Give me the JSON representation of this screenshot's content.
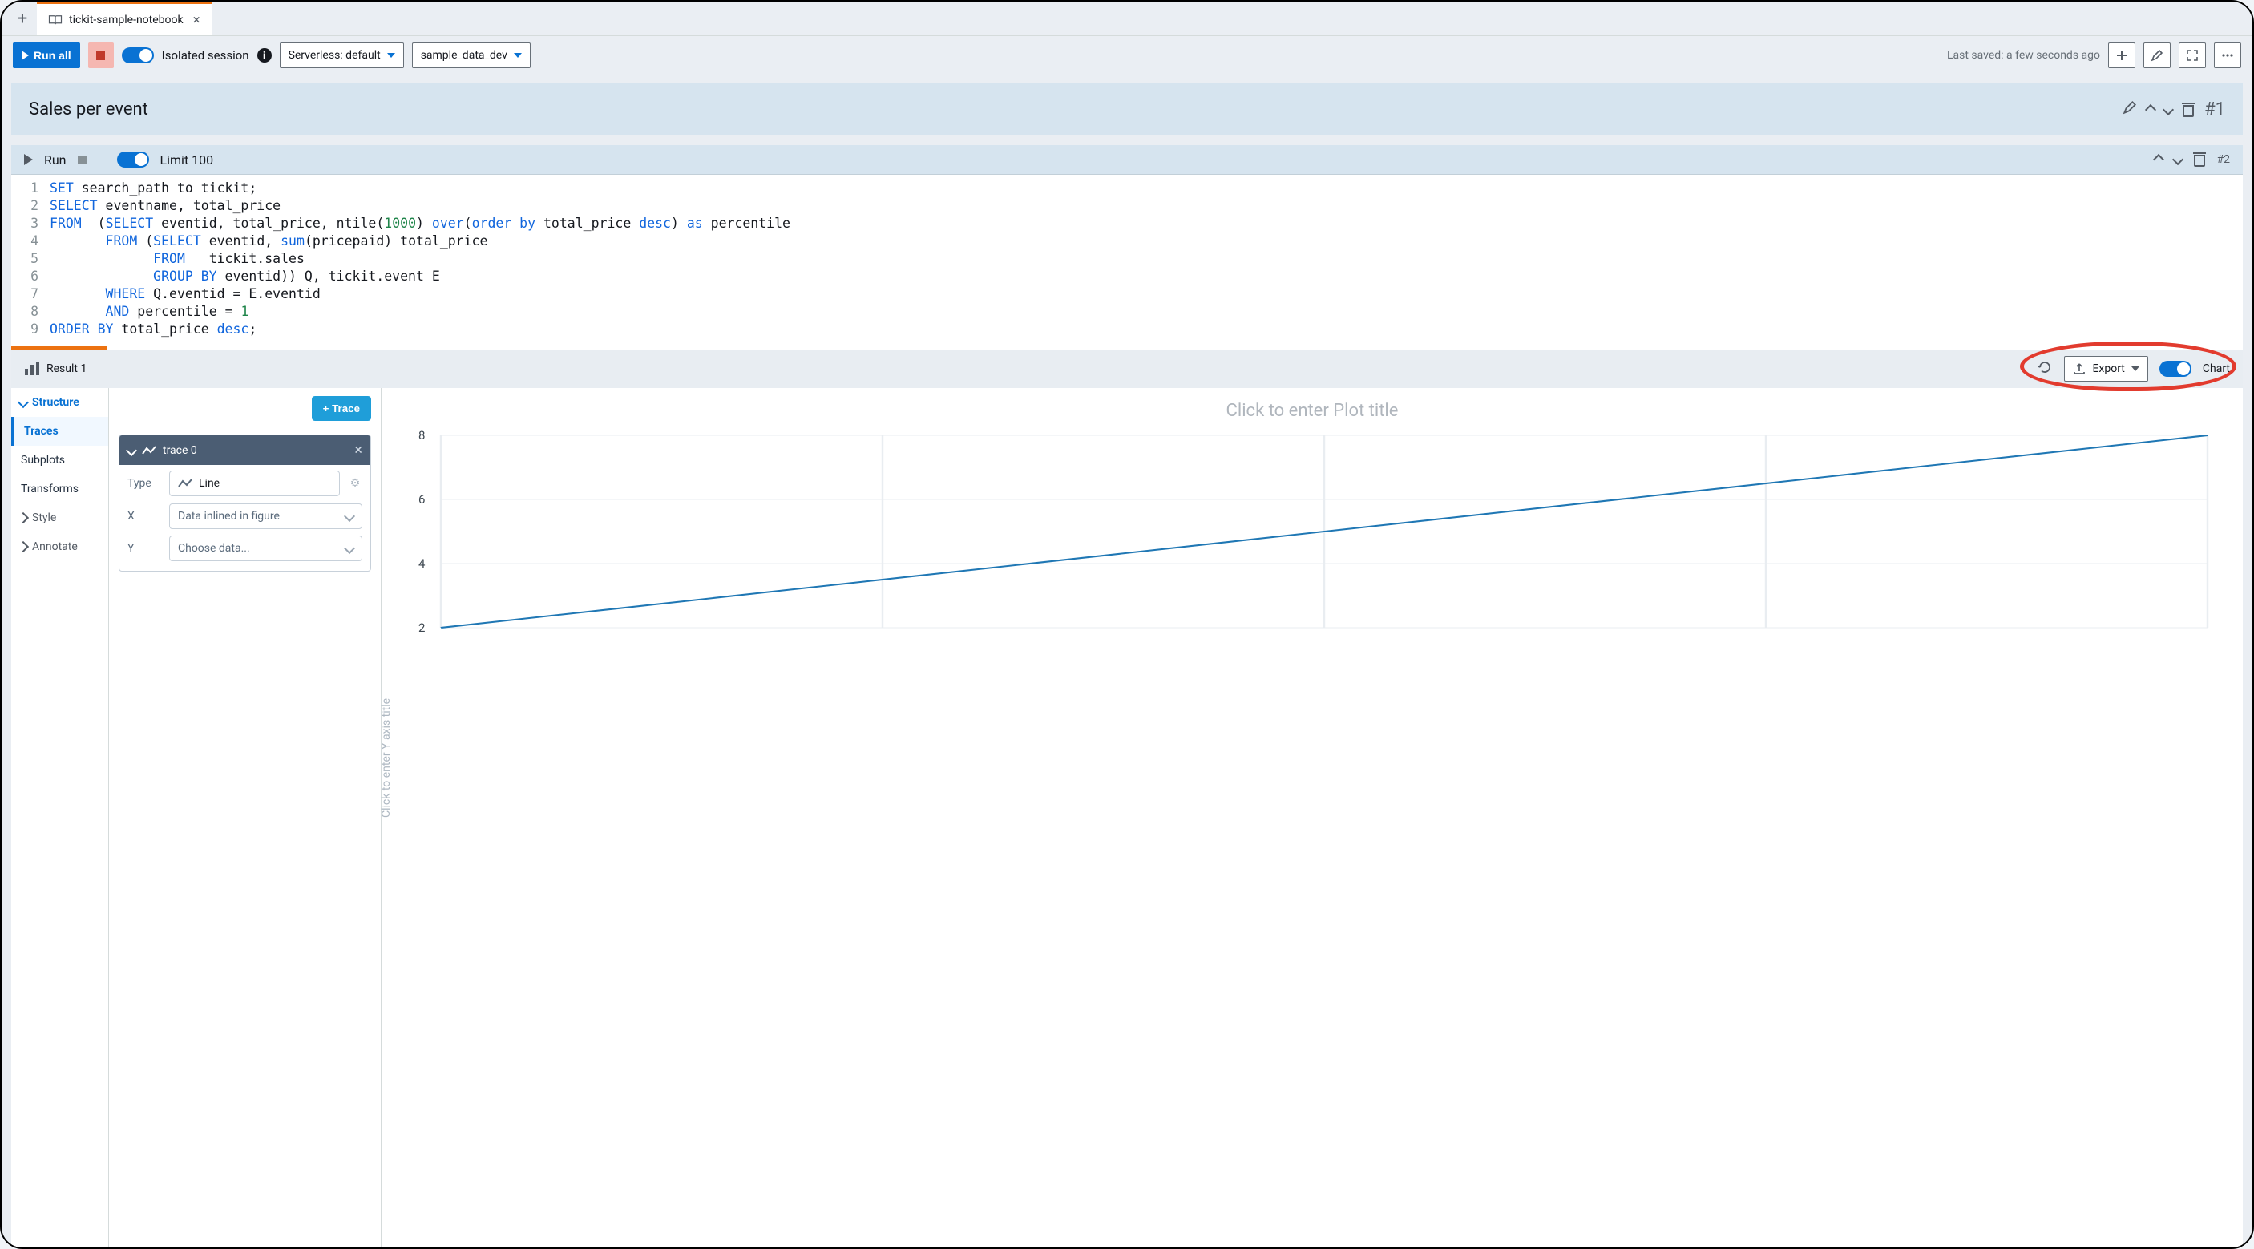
{
  "tab": {
    "title": "tickit-sample-notebook"
  },
  "toolbar": {
    "run_all": "Run all",
    "isolated_session": "Isolated session",
    "cluster": "Serverless: default",
    "database": "sample_data_dev",
    "last_saved": "Last saved: a few seconds ago"
  },
  "cell1": {
    "title": "Sales per event",
    "index": "#1"
  },
  "cell2": {
    "run": "Run",
    "limit": "Limit 100",
    "index": "#2",
    "lines": [
      "1",
      "2",
      "3",
      "4",
      "5",
      "6",
      "7",
      "8",
      "9"
    ],
    "code": {
      "l1a": "SET",
      "l1b": " search_path to tickit;",
      "l2a": "SELECT",
      "l2b": " eventname, total_price",
      "l3a": "FROM",
      "l3b": "  (",
      "l3c": "SELECT",
      "l3d": " eventid, total_price, ntile(",
      "l3e": "1000",
      "l3f": ") ",
      "l3g": "over",
      "l3h": "(",
      "l3i": "order by",
      "l3j": " total_price ",
      "l3k": "desc",
      "l3l": ") ",
      "l3m": "as",
      "l3n": " percentile",
      "l4a": "       ",
      "l4a2": "FROM",
      "l4b": " (",
      "l4c": "SELECT",
      "l4d": " eventid, ",
      "l4e": "sum",
      "l4f": "(pricepaid) total_price",
      "l5a": "             ",
      "l5b": "FROM",
      "l5c": "   tickit.sales",
      "l6a": "             ",
      "l6b": "GROUP BY",
      "l6c": " eventid)) Q, tickit.event E",
      "l7a": "       ",
      "l7b": "WHERE",
      "l7c": " Q.eventid = E.eventid",
      "l8a": "       ",
      "l8b": "AND",
      "l8c": " percentile = ",
      "l8d": "1",
      "l9a": "ORDER BY",
      "l9b": " total_price ",
      "l9c": "desc",
      "l9d": ";"
    }
  },
  "result": {
    "tab": "Result 1",
    "export": "Export",
    "chart_toggle": "Chart"
  },
  "structure": {
    "title": "Structure",
    "items": [
      "Traces",
      "Subplots",
      "Transforms"
    ],
    "style": "Style",
    "annotate": "Annotate",
    "add_trace": "Trace",
    "trace0": "trace 0",
    "type_label": "Type",
    "type_value": "Line",
    "x_label": "X",
    "x_value": "Data inlined in figure",
    "y_label": "Y",
    "y_value": "Choose data..."
  },
  "plot": {
    "title_placeholder": "Click to enter Plot title",
    "y_axis_placeholder": "Click to enter Y axis title"
  },
  "chart_data": {
    "type": "line",
    "title": "",
    "xlabel": "",
    "ylabel": "",
    "x": [
      0,
      1,
      2,
      3
    ],
    "values": [
      2,
      4,
      6,
      8
    ],
    "ylim": [
      2,
      8
    ],
    "yticks": [
      2,
      4,
      6,
      8
    ]
  }
}
